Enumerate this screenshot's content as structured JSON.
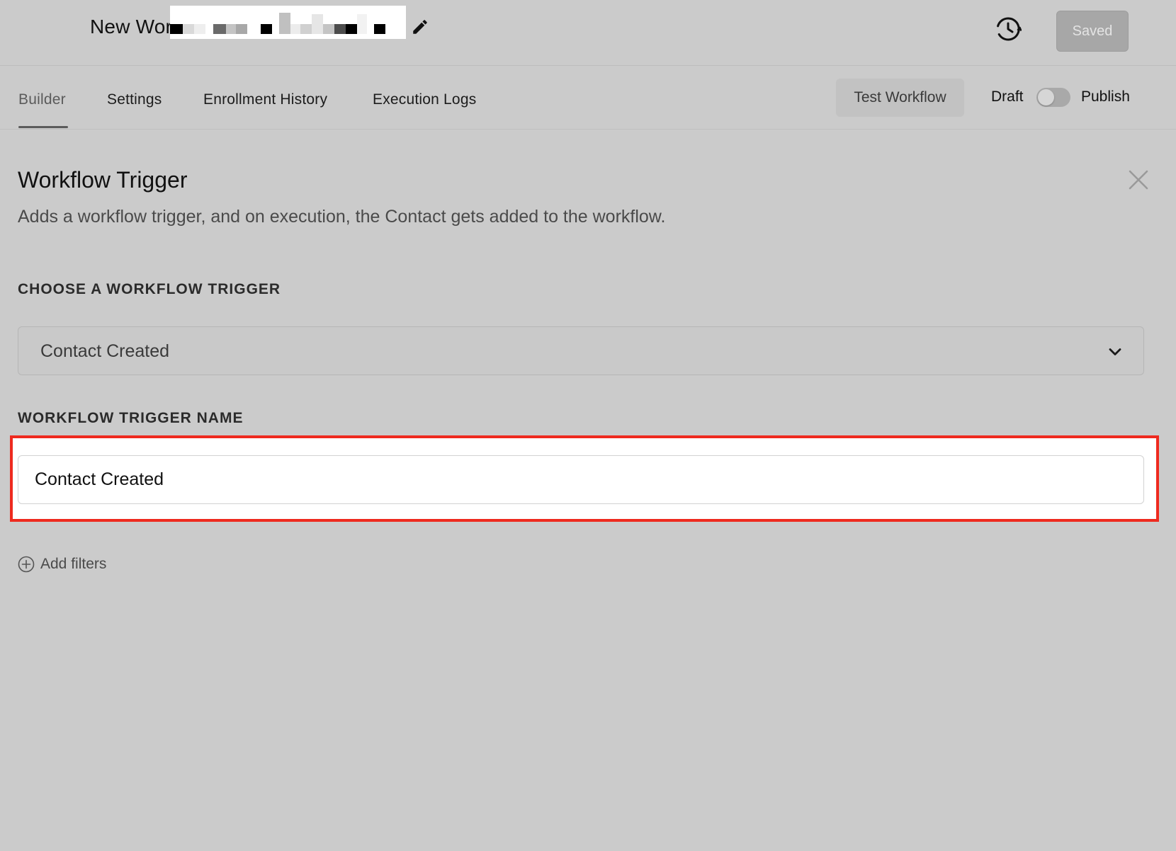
{
  "header": {
    "workflow_title": "New Wor",
    "saved_label": "Saved"
  },
  "tabs": [
    {
      "label": "Builder",
      "active": true
    },
    {
      "label": "Settings"
    },
    {
      "label": "Enrollment History"
    },
    {
      "label": "Execution Logs"
    }
  ],
  "actions": {
    "test_label": "Test Workflow",
    "draft_label": "Draft",
    "publish_label": "Publish",
    "publish_toggle_on": false
  },
  "panel": {
    "title": "Workflow Trigger",
    "description": "Adds a workflow trigger, and on execution, the Contact gets added to the workflow.",
    "trigger_label": "CHOOSE A WORKFLOW TRIGGER",
    "trigger_value": "Contact Created",
    "name_label": "WORKFLOW TRIGGER NAME",
    "name_value": "Contact Created",
    "add_filters_label": "Add filters"
  },
  "colors": {
    "background": "#cbcbcb",
    "highlight": "#ee2a1f",
    "saved_button": "#a7a7a7"
  },
  "icons": [
    "edit-icon",
    "history-icon",
    "close-icon",
    "chevron-down-icon",
    "plus-circle-icon"
  ]
}
